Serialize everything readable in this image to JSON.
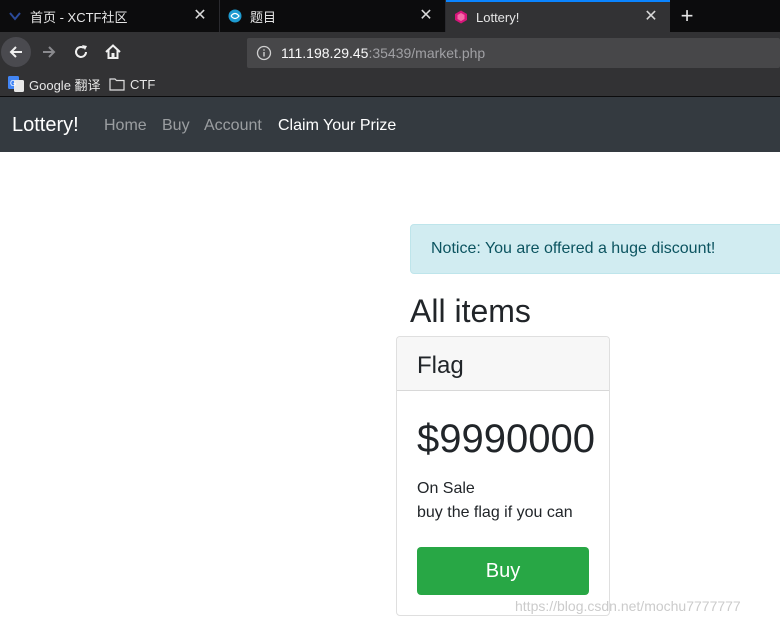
{
  "browser": {
    "tabs": [
      {
        "title": "首页 - XCTF社区",
        "active": false
      },
      {
        "title": "题目",
        "active": false
      },
      {
        "title": "Lottery!",
        "active": true
      }
    ],
    "new_tab_icon": "plus-icon",
    "url": {
      "host": "111.198.29.45",
      "rest": ":35439/market.php"
    },
    "bookmarks": [
      {
        "label": "Google 翻译",
        "icon": "google-translate-icon"
      },
      {
        "label": "CTF",
        "icon": "folder-icon"
      }
    ],
    "colors": {
      "tab_accent": "#0a84ff",
      "chrome_bg": "#323234"
    }
  },
  "site": {
    "brand": "Lottery!",
    "nav": {
      "home": "Home",
      "buy": "Buy",
      "account": "Account",
      "prize": "Claim Your Prize"
    },
    "notice": "Notice: You are offered a huge discount!",
    "section_title": "All items",
    "card": {
      "header": "Flag",
      "price": "$9990000",
      "line1": "On Sale",
      "line2": "buy the flag if you can",
      "button": "Buy"
    },
    "colors": {
      "navbar": "#343a40",
      "alert_bg": "#d1ecf1",
      "button": "#28a745"
    }
  },
  "watermark": "https://blog.csdn.net/mochu7777777"
}
